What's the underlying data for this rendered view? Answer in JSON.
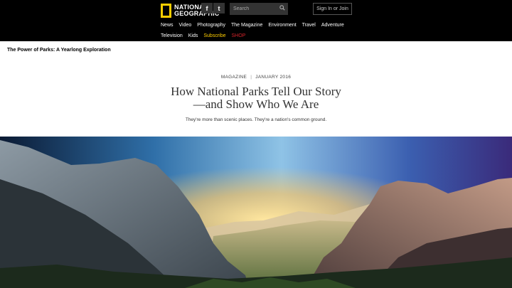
{
  "header": {
    "logo_text_line1": "NATIONAL",
    "logo_text_line2": "GEOGRAPHIC",
    "facebook_label": "f",
    "twitter_label": "t",
    "search_placeholder": "Search",
    "signin_label": "Sign In or Join"
  },
  "nav": {
    "row1": [
      "News",
      "Video",
      "Photography",
      "The Magazine",
      "Environment",
      "Travel",
      "Adventure"
    ],
    "row2": [
      "Television",
      "Kids"
    ],
    "subscribe": "Subscribe",
    "shop": "SHOP"
  },
  "article": {
    "series": "The Power of Parks: A Yearlong Exploration",
    "section": "MAGAZINE",
    "date": "JANUARY 2016",
    "title_line1": "How National Parks Tell Our Story",
    "title_line2": "—and Show Who We Are",
    "subtitle": "They're more than scenic places. They're a nation's common ground."
  },
  "colors": {
    "brand_yellow": "#ffce00",
    "shop_red": "#d2232a",
    "header_bg": "#000000"
  },
  "icons": {
    "logo": "yellow-rectangle-logo",
    "search": "search-icon",
    "facebook": "facebook-icon",
    "twitter": "twitter-icon"
  }
}
